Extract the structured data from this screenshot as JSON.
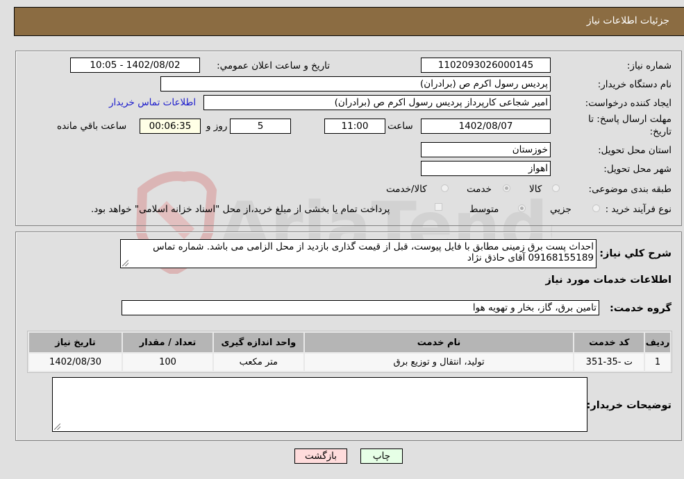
{
  "header": {
    "title": "جزئیات اطلاعات نیاز"
  },
  "form": {
    "need_number": {
      "label": "شماره نیاز:",
      "value": "1102093026000145"
    },
    "announce_datetime": {
      "label": "تاریخ و ساعت اعلان عمومي:",
      "value": "1402/08/02 - 10:05"
    },
    "buyer_org": {
      "label": "نام دستگاه خريدار:",
      "value": "پرديس رسول اکرم ص (برادران)"
    },
    "requester": {
      "label": "ایجاد کننده درخواست:",
      "value": "امیر  شجاعی کارپرداز پرديس رسول اکرم ص (برادران)"
    },
    "buyer_contact_link": "اطلاعات تماس خریدار",
    "deadline": {
      "label_line1": "مهلت ارسال پاسخ: تا",
      "label_line2": "تاریخ:",
      "date": "1402/08/07",
      "time_label": "ساعت",
      "time": "11:00",
      "days": "5",
      "days_label": "روز و",
      "remaining": "00:06:35",
      "remaining_label": "ساعت باقي مانده"
    },
    "province": {
      "label": "استان محل تحویل:",
      "value": "خوزستان"
    },
    "city": {
      "label": "شهر محل تحویل:",
      "value": "اهواز"
    },
    "category": {
      "label": "طبقه بندی موضوعی:",
      "options": [
        "کالا",
        "خدمت",
        "کالا/خدمت"
      ],
      "selected": "خدمت"
    },
    "purchase_type": {
      "label": "نوع فرآیند خرید :",
      "options": [
        "جزيي",
        "متوسط"
      ],
      "selected": "متوسط",
      "treasury_checkbox_label": "پرداخت تمام یا بخشی از مبلغ خرید،از محل \"اسناد خزانه اسلامی\" خواهد بود.",
      "treasury_checked": false
    }
  },
  "description": {
    "label": "شرح کلي نياز:",
    "value": "احداث پست برق زمینی مطابق با فایل پیوست، قبل از قیمت گذاری بازدید از محل الزامی می باشد. شماره تماس 09168155189 آقای حاذق نژاد"
  },
  "services_section": {
    "title": "اطلاعات خدمات مورد نیاز",
    "service_group": {
      "label": "گروه خدمت:",
      "value": "تامین برق، گاز، بخار و تهویه هوا"
    },
    "table": {
      "columns": [
        "ردیف",
        "کد خدمت",
        "نام خدمت",
        "واحد اندازه گیری",
        "تعداد / مقدار",
        "تاریخ نیاز"
      ],
      "rows": [
        [
          "1",
          "ت -35-351",
          "تولید، انتقال و توزیع برق",
          "متر مکعب",
          "100",
          "1402/08/30"
        ]
      ]
    }
  },
  "buyer_notes": {
    "label": "توضیحات خریدار:",
    "value": ""
  },
  "buttons": {
    "print": "چاپ",
    "back": "بازگشت"
  },
  "colors": {
    "header_bg": "#8b6c42",
    "back_button_bg": "#ffdcdc",
    "print_button_bg": "#e6ffe6",
    "remaining_bg": "#ffffe6",
    "link": "#1a1acc"
  }
}
